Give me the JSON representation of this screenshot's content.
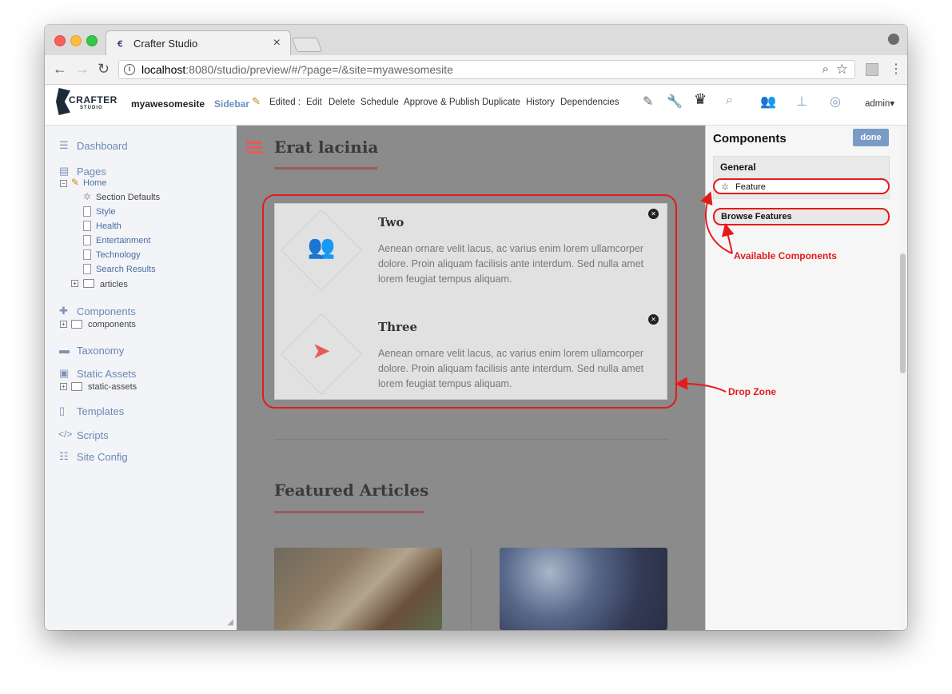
{
  "browser": {
    "tab_title": "Crafter Studio",
    "tab_close": "×",
    "url_host": "localhost",
    "url_rest": ":8080/studio/preview/#/?page=/&site=myawesomesite"
  },
  "toolbar": {
    "logo_word": "CRAFTER",
    "logo_sub": "STUDIO",
    "site_name": "myawesomesite",
    "sidebar_label": "Sidebar",
    "edited_label": "Edited :",
    "actions": [
      "Edit",
      "Delete",
      "Schedule",
      "Approve & Publish",
      "Duplicate",
      "History",
      "Dependencies"
    ],
    "user": "admin▾"
  },
  "sidebar": {
    "dashboard": "Dashboard",
    "pages": "Pages",
    "home": "Home",
    "home_children": [
      "Section Defaults",
      "Style",
      "Health",
      "Entertainment",
      "Technology",
      "Search Results"
    ],
    "articles": "articles",
    "components": "Components",
    "components_folder": "components",
    "taxonomy": "Taxonomy",
    "static_assets": "Static Assets",
    "static_assets_folder": "static-assets",
    "templates": "Templates",
    "scripts": "Scripts",
    "site_config": "Site Config"
  },
  "preview": {
    "section_title": "Erat lacinia",
    "features": [
      {
        "title": "Two",
        "text": "Aenean ornare velit lacus, ac varius enim lorem ullamcorper dolore. Proin aliquam facilisis ante interdum. Sed nulla amet lorem feugiat tempus aliquam.",
        "icon": "users-icon"
      },
      {
        "title": "Three",
        "text": "Aenean ornare velit lacus, ac varius enim lorem ullamcorper dolore. Proin aliquam facilisis ante interdum. Sed nulla amet lorem feugiat tempus aliquam.",
        "icon": "paper-plane-icon"
      }
    ],
    "featured_title": "Featured Articles"
  },
  "components_panel": {
    "title": "Components",
    "done": "done",
    "general": "General",
    "feature_item": "Feature",
    "browse": "Browse Features"
  },
  "annotations": {
    "available": "Available Components",
    "drop_zone": "Drop Zone",
    "color": "#e41b1b"
  }
}
